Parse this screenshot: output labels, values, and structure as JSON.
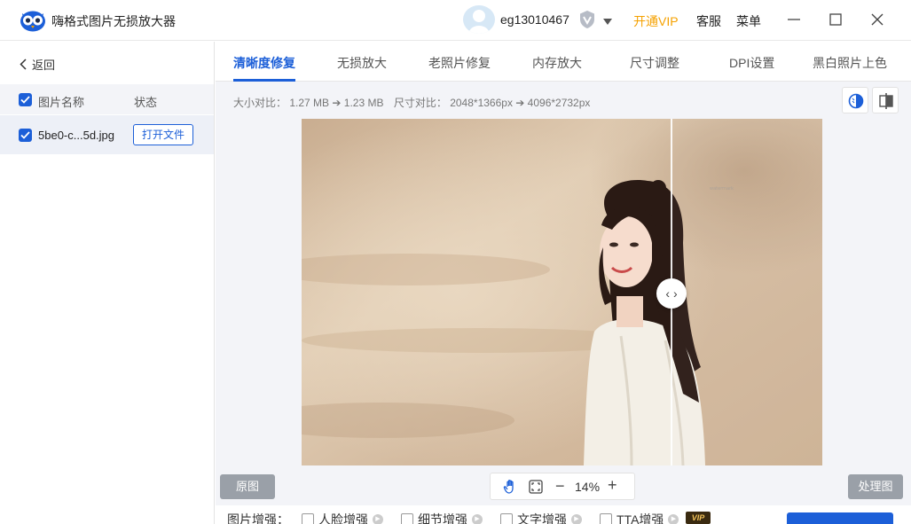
{
  "app": {
    "title": "嗨格式图片无损放大器"
  },
  "user": {
    "name": "eg13010467",
    "vip_link": "开通VIP",
    "service": "客服",
    "menu": "菜单"
  },
  "sidebar": {
    "back_label": "返回",
    "header": {
      "name": "图片名称",
      "status": "状态"
    },
    "files": [
      {
        "name": "5be0-c...5d.jpg",
        "action": "打开文件"
      }
    ]
  },
  "tabs": [
    "清晰度修复",
    "无损放大",
    "老照片修复",
    "内存放大",
    "尺寸调整",
    "DPI设置",
    "黑白照片上色"
  ],
  "active_tab": "清晰度修复",
  "info": {
    "size_label": "大小对比：",
    "size_from": "1.27 MB",
    "size_to": "1.23 MB",
    "dim_label": "尺寸对比：",
    "dim_from": "2048*1366px",
    "dim_to": "4096*2732px"
  },
  "preview": {
    "compare_position": 0.71
  },
  "buttons": {
    "original": "原图",
    "processed": "处理图"
  },
  "zoom": {
    "value": "14%"
  },
  "enhance": {
    "label": "图片增强：",
    "options": [
      "人脸增强",
      "细节增强",
      "文字增强",
      "TTA增强"
    ],
    "vip_badge": "VIP"
  },
  "colors": {
    "accent": "#1c5fd8",
    "vip": "#f5a100"
  }
}
